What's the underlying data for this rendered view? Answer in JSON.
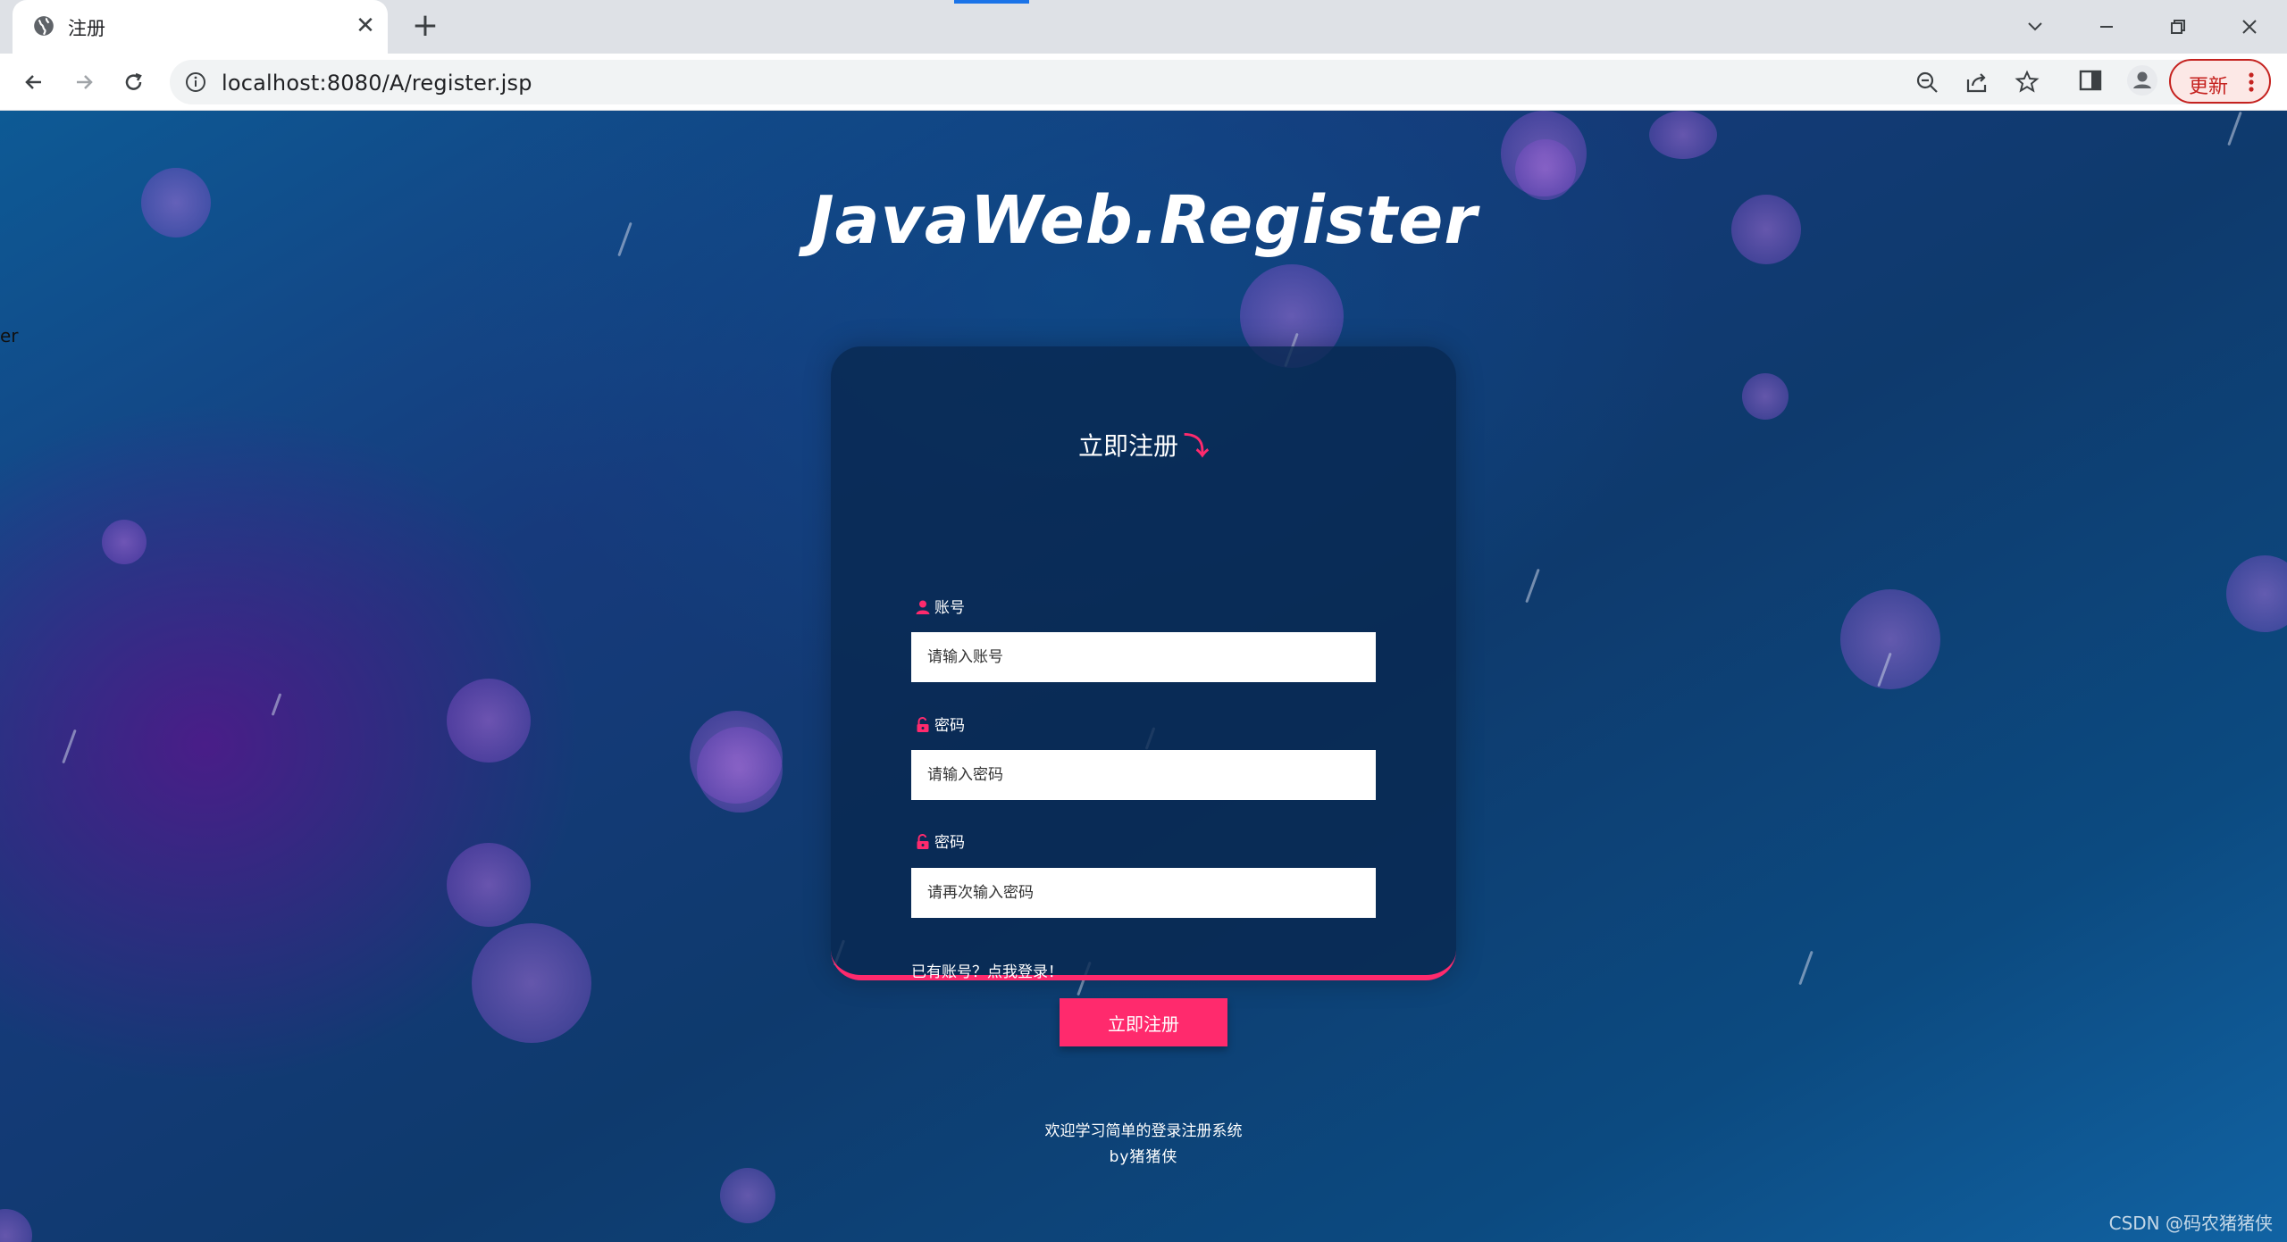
{
  "browser": {
    "tab": {
      "title": "注册",
      "close_glyph": "✕",
      "icon": "globe-icon"
    },
    "new_tab_glyph": "+",
    "url": "localhost:8080/A/register.jsp",
    "update_label": "更新"
  },
  "page": {
    "side_fragment": "er",
    "title": "JavaWeb.Register",
    "form": {
      "heading": "立即注册",
      "heading_arrow": "⤵",
      "account_label": "账号",
      "account_placeholder": "请输入账号",
      "password_label": "密码",
      "password_placeholder": "请输入密码",
      "confirm_label": "密码",
      "confirm_placeholder": "请再次输入密码",
      "login_link": "已有账号？点我登录！",
      "submit_label": "立即注册"
    },
    "footer": {
      "line1": "欢迎学习简单的登录注册系统",
      "line2": "by猪猪侠"
    },
    "watermark": "CSDN @码农猪猪侠"
  },
  "colors": {
    "accent": "#ff2a6d",
    "card": "#082850",
    "update_red": "#c5221f"
  }
}
